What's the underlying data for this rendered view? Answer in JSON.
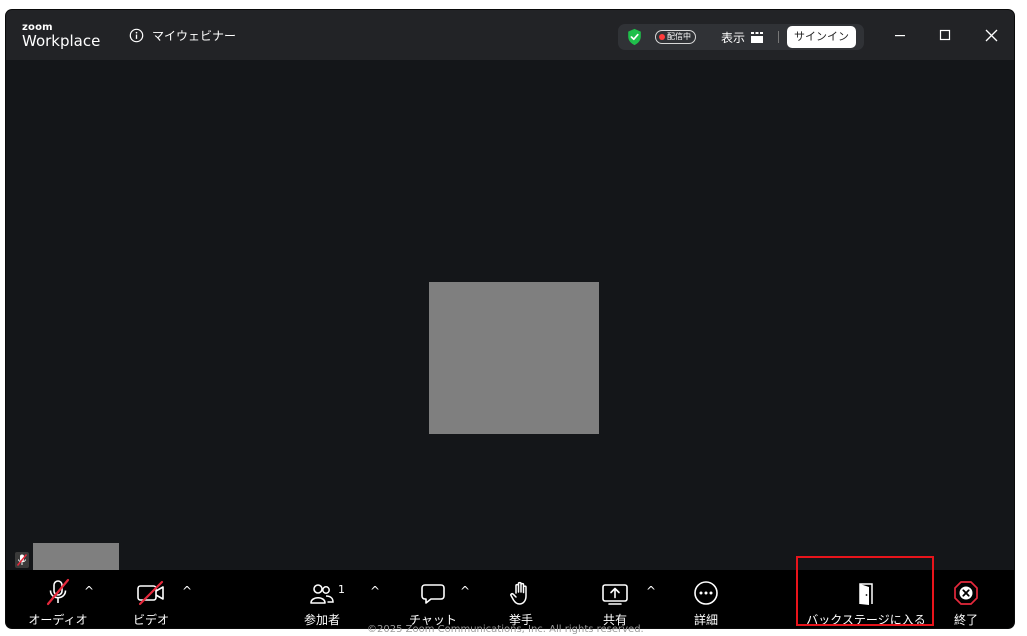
{
  "app": {
    "logo_top": "zoom",
    "logo_bottom": "Workplace"
  },
  "header": {
    "info_label": "マイウェビナー",
    "live_badge": "配信中",
    "view_label": "表示",
    "signin_label": "サインイン"
  },
  "toolbar": {
    "audio_label": "オーディオ",
    "video_label": "ビデオ",
    "participants_label": "参加者",
    "participants_count": "1",
    "chat_label": "チャット",
    "raise_hand_label": "挙手",
    "share_label": "共有",
    "more_label": "詳細",
    "backstage_label": "バックステージに入る",
    "end_label": "終了"
  },
  "footer_text": "©2025 Zoom Communications, Inc. All rights reserved.",
  "colors": {
    "accent_green": "#1fbf4b",
    "mute_red": "#e5293c",
    "end_red": "#e5293c",
    "highlight_red": "#e8141b"
  }
}
